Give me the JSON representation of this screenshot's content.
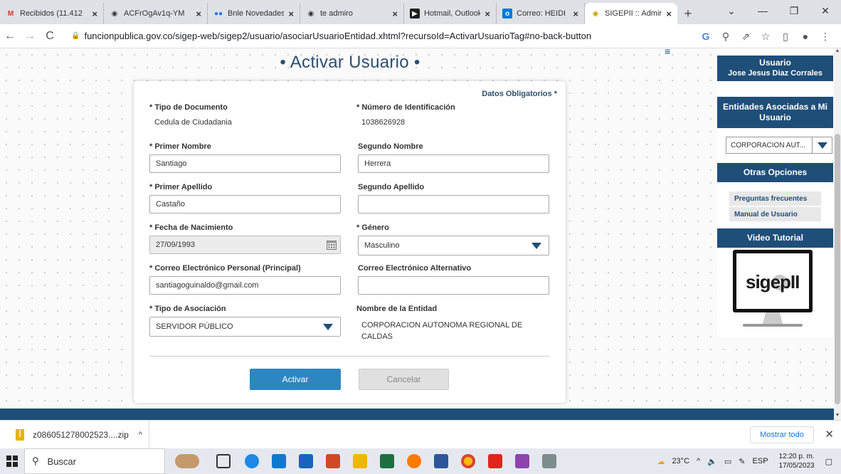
{
  "browser": {
    "tabs": [
      {
        "label": "Recibidos (11.412",
        "favicon": "gmail-icon",
        "color": "#d93025"
      },
      {
        "label": "ACFrOgAv1q-YM",
        "favicon": "globe-icon",
        "color": "#555555"
      },
      {
        "label": "Bnle Novedades",
        "favicon": "bnle-icon",
        "color": "#1a73e8"
      },
      {
        "label": "te admiro",
        "favicon": "globe-icon",
        "color": "#555555"
      },
      {
        "label": "Hotmail, Outlook",
        "favicon": "msn-icon",
        "color": "#1f1f1f"
      },
      {
        "label": "Correo: HEIDI MA",
        "favicon": "outlook-icon",
        "color": "#0078d4"
      },
      {
        "label": "SIGEPII :: Admini",
        "favicon": "sigep-icon",
        "color": "#c8a400"
      }
    ],
    "url": "funcionpublica.gov.co/sigep-web/sigep2/usuario/asociarUsuarioEntidad.xhtml?recursoId=ActivarUsuarioTag#no-back-button"
  },
  "page": {
    "title": "• Activar Usuario •",
    "required_note": "Datos Obligatorios *"
  },
  "form": {
    "tipo_documento": {
      "label": "* Tipo de Documento",
      "value": "Cedula de Ciudadania"
    },
    "numero_id": {
      "label": "* Número de Identificación",
      "value": "1038626928"
    },
    "primer_nombre": {
      "label": "* Primer Nombre",
      "value": "Santiago"
    },
    "segundo_nombre": {
      "label": "Segundo Nombre",
      "value": "Herrera"
    },
    "primer_apellido": {
      "label": "* Primer Apellido",
      "value": "Castaño"
    },
    "segundo_apellido": {
      "label": "Segundo Apellido",
      "value": ""
    },
    "fecha_nacimiento": {
      "label": "* Fecha de Nacimiento",
      "value": "27/09/1993"
    },
    "genero": {
      "label": "* Género",
      "value": "Masculino"
    },
    "correo_personal": {
      "label": "* Correo Electrónico Personal (Principal)",
      "value": "santiagoguinaldo@gmail.com"
    },
    "correo_alternativo": {
      "label": "Correo Electrónico Alternativo",
      "value": ""
    },
    "tipo_asociacion": {
      "label": "* Tipo de Asociación",
      "value": "SERVIDOR PÚBLICO"
    },
    "nombre_entidad": {
      "label": "Nombre de la Entidad",
      "value_line1": "CORPORACION AUTONOMA REGIONAL DE",
      "value_line2": "CALDAS"
    },
    "activar_label": "Activar",
    "cancelar_label": "Cancelar"
  },
  "sidebar": {
    "usuario_title": "Usuario",
    "usuario_name": "Jose Jesus Diaz Corrales",
    "entidades_line1": "Entidades Asociadas a Mi",
    "entidades_line2": "Usuario",
    "entidad_selected": "CORPORACION AUT...",
    "otras_opciones": "Otras Opciones",
    "links": [
      "Preguntas frecuentes",
      "Manual de Usuario"
    ],
    "video_title": "Video Tutorial",
    "video_brand": "sigepII"
  },
  "downloads": {
    "file": "z086051278002523....zip",
    "show_all": "Mostrar todo"
  },
  "taskbar": {
    "search_placeholder": "Buscar",
    "temperature": "23°C",
    "language": "ESP",
    "time": "12:20 p. m.",
    "date": "17/05/2023"
  },
  "colors": {
    "primary": "#1f4e79",
    "accent_button": "#2e86c1"
  }
}
